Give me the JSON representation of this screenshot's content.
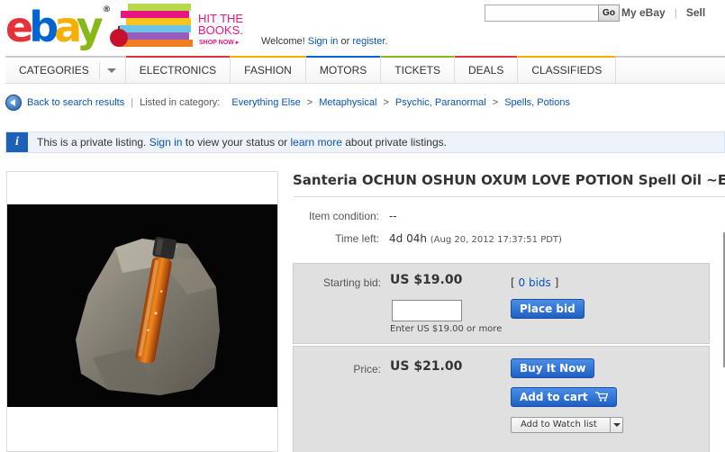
{
  "header": {
    "logo": {
      "letters": [
        "e",
        "b",
        "a",
        "y"
      ],
      "colors": [
        "#e53238",
        "#0064d2",
        "#f5af02",
        "#86b817"
      ],
      "trademark": "®"
    },
    "promo": {
      "line1": "HIT THE",
      "line2": "BOOKS.",
      "cta": "SHOP NOW ▸"
    },
    "welcome": {
      "prefix": "Welcome!",
      "sign_in": "Sign in",
      "or": "or",
      "register": "register",
      "suffix": "."
    },
    "search": {
      "placeholder": "",
      "go_label": "Go"
    },
    "links": {
      "my_ebay": "My eBay",
      "sell": "Sell"
    }
  },
  "nav": {
    "items": [
      {
        "label": "CATEGORIES",
        "accent": ""
      },
      {
        "label": "ELECTRONICS",
        "accent": "#e53238"
      },
      {
        "label": "FASHION",
        "accent": "#f5af02"
      },
      {
        "label": "MOTORS",
        "accent": "#0064d2"
      },
      {
        "label": "TICKETS",
        "accent": "#86b817"
      },
      {
        "label": "DEALS",
        "accent": "#e53238"
      },
      {
        "label": "CLASSIFIEDS",
        "accent": "#f5af02"
      }
    ]
  },
  "breadcrumb": {
    "back": "Back to search results",
    "listed_in": "Listed in category:",
    "path": [
      "Everything Else",
      "Metaphysical",
      "Psychic, Paranormal",
      "Spells, Potions"
    ]
  },
  "notice": {
    "prefix": "This is a private listing.",
    "sign_in": "Sign in",
    "mid": "to view your status or",
    "learn_more": "learn more",
    "suffix": "about private listings."
  },
  "listing": {
    "title": "Santeria OCHUN OSHUN OXUM LOVE POTION Spell Oil ~Ext",
    "condition_label": "Item condition:",
    "condition_value": "--",
    "time_label": "Time left:",
    "time_value": "4d 04h",
    "time_detail": "(Aug 20, 2012  17:37:51 PDT)",
    "bid": {
      "label": "Starting bid:",
      "price": "US $19.00",
      "bids_open": "[",
      "bids_link": "0 bids",
      "bids_close": "]",
      "button": "Place bid",
      "input_value": "",
      "note": "Enter US $19.00 or more"
    },
    "buy": {
      "label": "Price:",
      "price": "US $21.00",
      "buy_now": "Buy It Now",
      "add_to_cart": "Add to cart",
      "watch": "Add to Watch list"
    }
  }
}
